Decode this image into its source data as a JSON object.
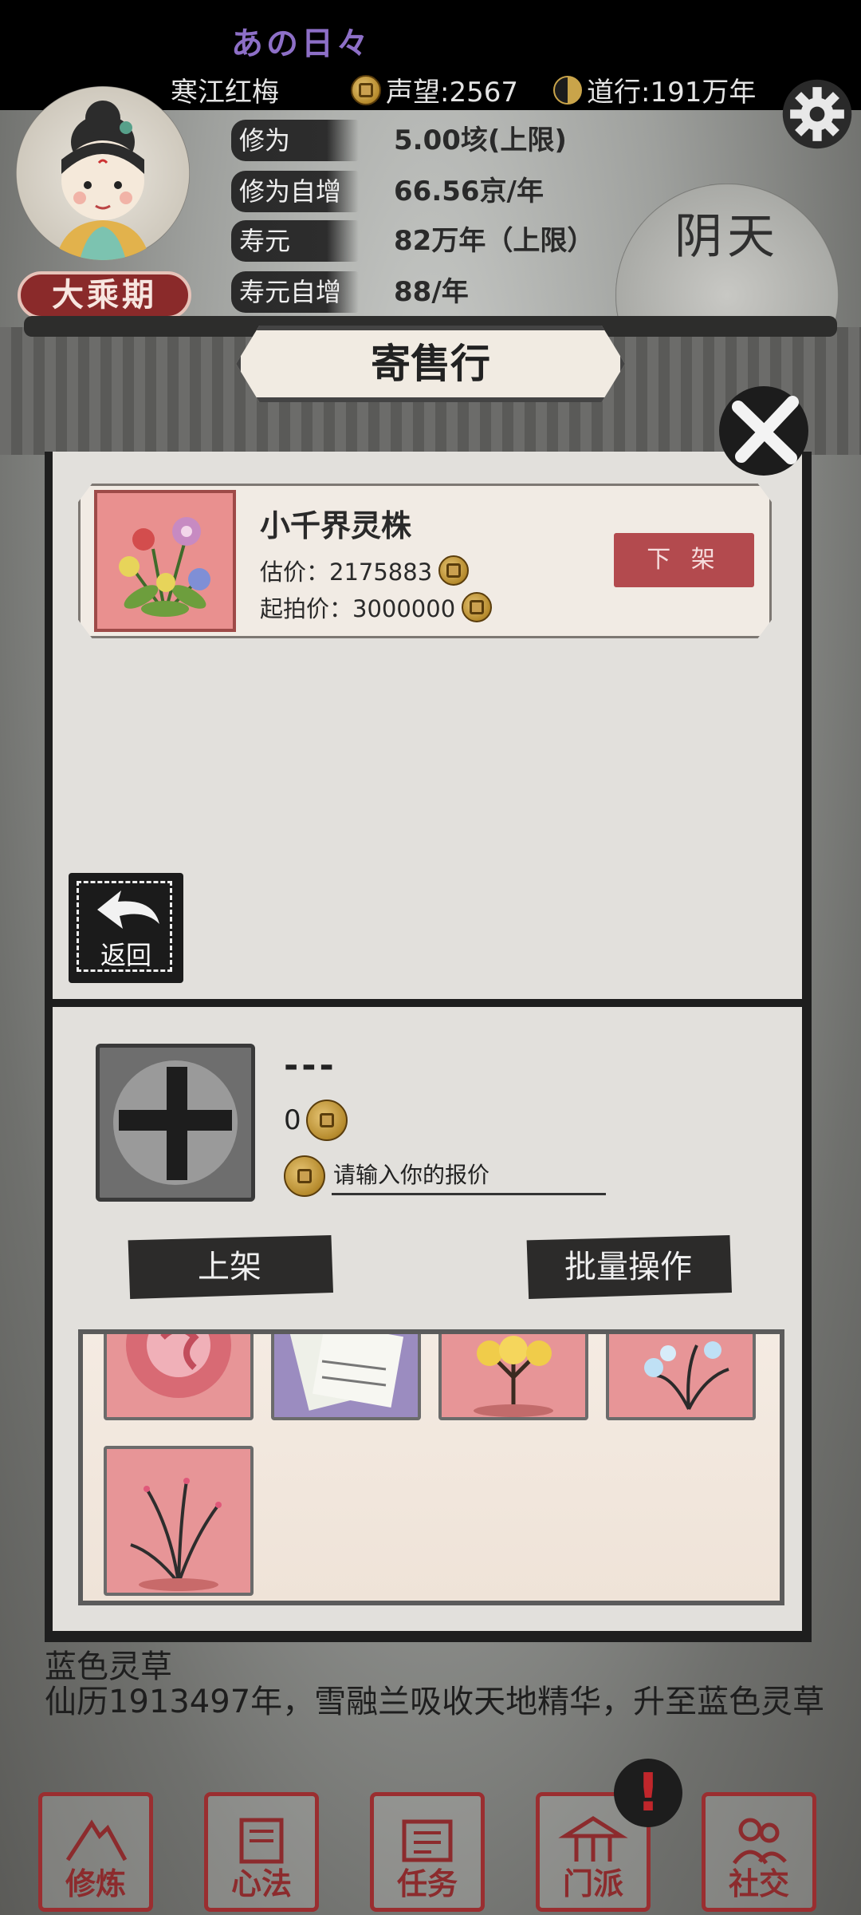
{
  "header": {
    "title": "あの日々",
    "player_name": "寒江红梅",
    "reputation": "声望:2567",
    "daoxing": "道行:191万年"
  },
  "profile": {
    "realm": "大乘期",
    "stats": [
      {
        "label": "修为",
        "value": "5.00垓(上限)"
      },
      {
        "label": "修为自增",
        "value": "66.56京/年"
      },
      {
        "label": "寿元",
        "value": "82万年（上限）"
      },
      {
        "label": "寿元自增",
        "value": "88/年"
      }
    ],
    "weather": "阴天"
  },
  "dialog": {
    "title": "寄售行",
    "listing": {
      "name": "小千界灵株",
      "estimate": "估价：2175883",
      "start_price": "起拍价：3000000",
      "unlist_label": "下 架"
    },
    "back_label": "返回",
    "form": {
      "item_name": "---",
      "item_value": "0",
      "bid_placeholder": "请输入你的报价",
      "list_button": "上架",
      "batch_button": "批量操作"
    }
  },
  "log": {
    "line1": "蓝色灵草",
    "line2": "仙历1913497年，雪融兰吸收天地精华，升至蓝色灵草"
  },
  "nav": [
    {
      "label": "修炼"
    },
    {
      "label": "心法"
    },
    {
      "label": "任务"
    },
    {
      "label": "门派"
    },
    {
      "label": "社交"
    }
  ],
  "nav_alert": "!",
  "colors": {
    "accent_red": "#9a2e30",
    "unlist_button": "#b34a4e",
    "title_purple": "#8d6fc7"
  }
}
